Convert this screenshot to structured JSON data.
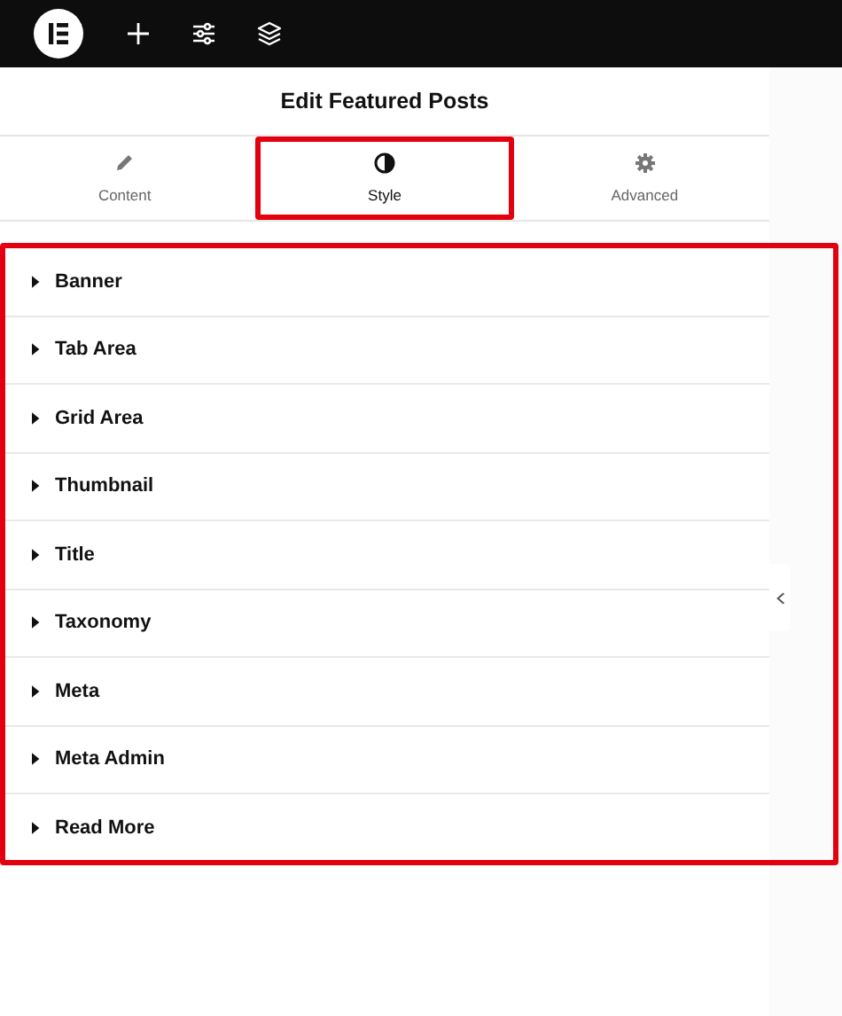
{
  "panel": {
    "title": "Edit Featured Posts"
  },
  "tabs": [
    {
      "label": "Content",
      "kind": "pencil",
      "selected": false,
      "highlighted": false
    },
    {
      "label": "Style",
      "kind": "contrast",
      "selected": true,
      "highlighted": true
    },
    {
      "label": "Advanced",
      "kind": "gear",
      "selected": false,
      "highlighted": false
    }
  ],
  "sections_highlighted": true,
  "sections": [
    {
      "label": "Banner",
      "expanded": false
    },
    {
      "label": "Tab Area",
      "expanded": false
    },
    {
      "label": "Grid Area",
      "expanded": false
    },
    {
      "label": "Thumbnail",
      "expanded": false
    },
    {
      "label": "Title",
      "expanded": false
    },
    {
      "label": "Taxonomy",
      "expanded": false
    },
    {
      "label": "Meta",
      "expanded": false
    },
    {
      "label": "Meta Admin",
      "expanded": false
    },
    {
      "label": "Read More",
      "expanded": false
    }
  ]
}
